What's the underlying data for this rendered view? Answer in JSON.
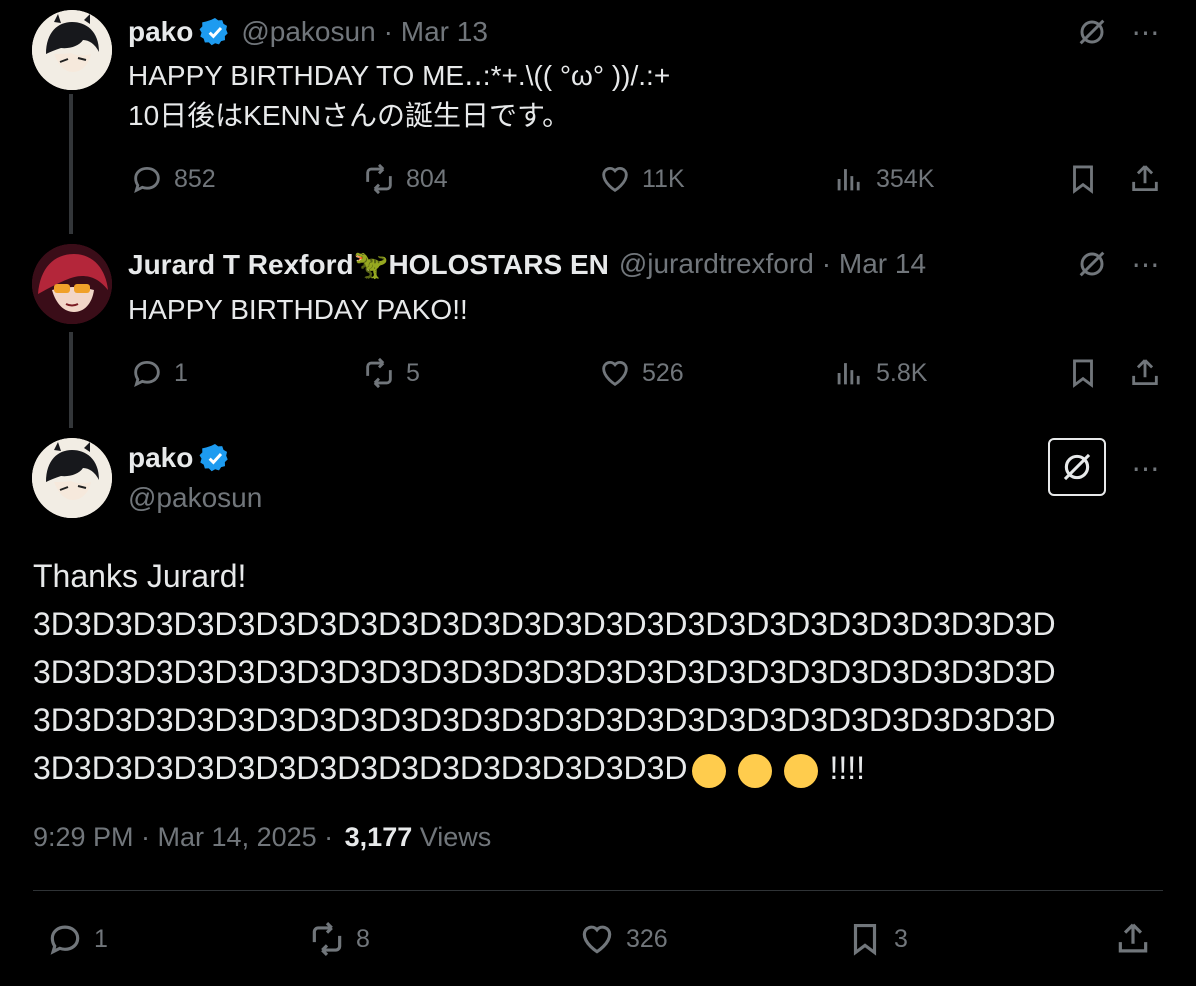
{
  "reply1": {
    "name": "pako",
    "handle": "@pakosun",
    "date": "· Mar 13",
    "lines": [
      "HAPPY BIRTHDAY TO ME‥:*+.\\(( °ω° ))/.:+",
      "10日後はKENNさんの誕生日です。"
    ],
    "replies": "852",
    "reposts": "804",
    "likes": "11K",
    "views": "354K"
  },
  "reply2": {
    "name": "Jurard T Rexford🦖HOLOSTARS EN",
    "handle": "@jurardtrexford",
    "date": "· Mar 14",
    "text": "HAPPY BIRTHDAY PAKO!!",
    "replies": "1",
    "reposts": "5",
    "likes": "526",
    "views": "5.8K"
  },
  "main": {
    "name": "pako",
    "handle": "@pakosun",
    "lines": [
      "Thanks Jurard!",
      "3D3D3D3D3D3D3D3D3D3D3D3D3D3D3D3D3D3D3D3D3D3D3D3D3D",
      "3D3D3D3D3D3D3D3D3D3D3D3D3D3D3D3D3D3D3D3D3D3D3D3D3D",
      "3D3D3D3D3D3D3D3D3D3D3D3D3D3D3D3D3D3D3D3D3D3D3D3D3D",
      "3D3D3D3D3D3D3D3D3D3D3D3D3D3D3D3D"
    ],
    "emoji_suffix": "!!!!",
    "timestamp": "9:29 PM · Mar 14, 2025 ·",
    "view_count": "3,177",
    "views_label": "Views",
    "replies": "1",
    "reposts": "8",
    "likes": "326",
    "bookmarks": "3"
  },
  "icons": {
    "more": "⋯"
  },
  "colors": {
    "verified": "#1d9bf0",
    "muted": "#71767b",
    "background": "#000000"
  }
}
